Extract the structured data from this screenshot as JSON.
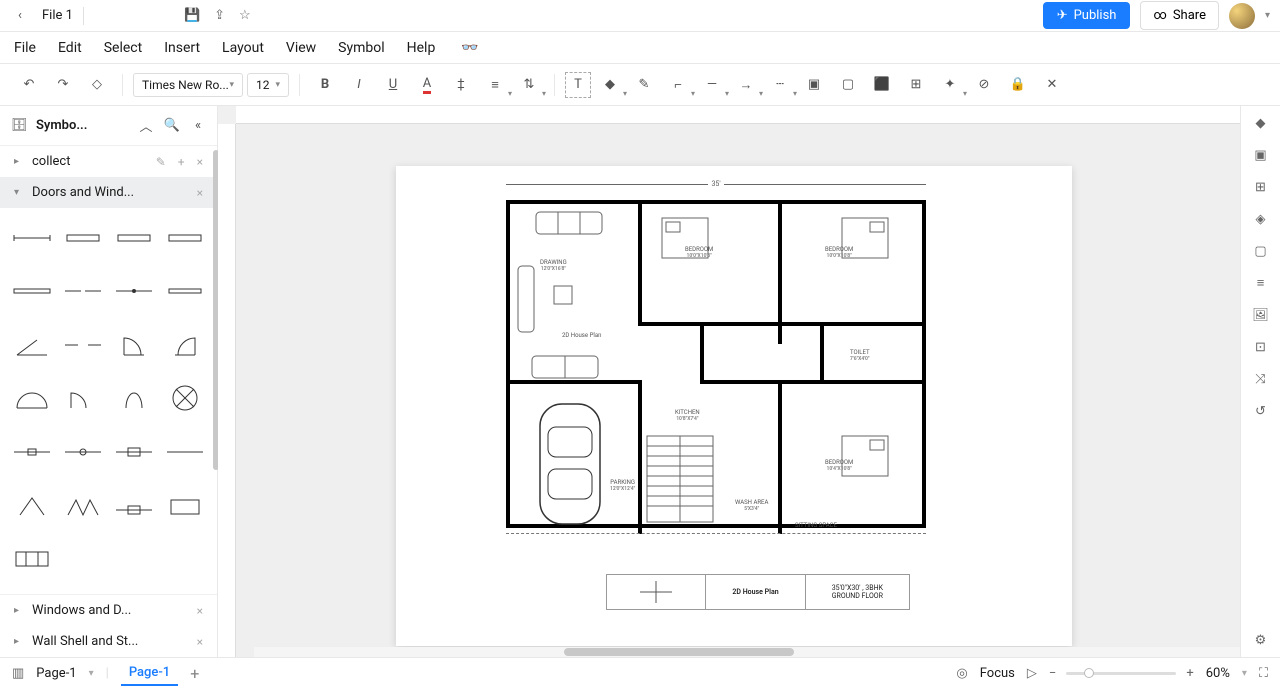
{
  "title_bar": {
    "file_name": "File 1"
  },
  "buttons": {
    "publish": "Publish",
    "share": "Share"
  },
  "menu": [
    "File",
    "Edit",
    "Select",
    "Insert",
    "Layout",
    "View",
    "Symbol",
    "Help"
  ],
  "toolbar": {
    "font": "Times New Ro...",
    "size": "12"
  },
  "side": {
    "title": "Symbo...",
    "collect": "collect",
    "doors": "Doors and Wind...",
    "windows": "Windows and D...",
    "wall": "Wall Shell and St..."
  },
  "canvas": {
    "dim_top": "35'",
    "plan_label": "2D House Plan",
    "drawing": "DRAWING",
    "drawing_sz": "12'0\"X16'8\"",
    "bedroom1": "BEDROOM",
    "bedroom1_sz": "10'0\"X10'8\"",
    "bedroom2": "BEDROOM",
    "bedroom2_sz": "10'0\"X10'8\"",
    "toilet": "TOILET",
    "toilet_sz": "7'6\"X4'0\"",
    "kitchen": "KITCHEN",
    "kitchen_sz": "10'8\"X7'4\"",
    "parking": "PARKING",
    "parking_sz": "12'0\"X12'4\"",
    "wash": "WASH AREA",
    "wash_sz": "5'X3'4\"",
    "sitting": "SITTING SPACE",
    "bedroom3": "BEDROOM",
    "bedroom3_sz": "10'4\"X10'8\"",
    "legend_title": "2D House Plan",
    "legend_dim": "35'0\"X30' , 3BHK",
    "legend_floor": "GROUND FLOOR"
  },
  "status": {
    "page_sel": "Page-1",
    "tab": "Page-1",
    "focus": "Focus",
    "zoom": "60%"
  }
}
